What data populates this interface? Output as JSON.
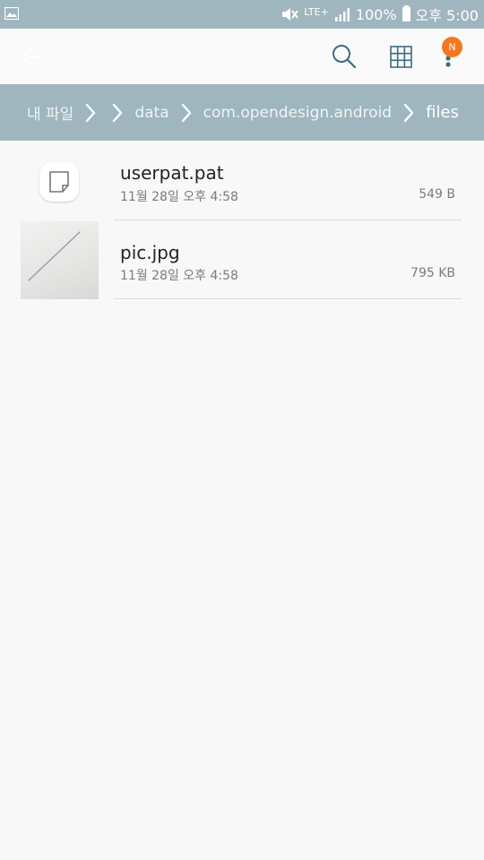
{
  "status_bar": {
    "network": "LTE+",
    "battery": "100%",
    "time": "오후 5:00"
  },
  "app_bar": {
    "notification_badge": "N",
    "accent_color": "#f4781f"
  },
  "breadcrumb": [
    "내 파일",
    "data",
    "com.opendesign.android",
    "files"
  ],
  "files": [
    {
      "name": "userpat.pat",
      "date": "11월 28일 오후 4:58",
      "size": "549 B",
      "icon": "document-icon"
    },
    {
      "name": "pic.jpg",
      "date": "11월 28일 오후 4:58",
      "size": "795 KB",
      "icon": "image-thumbnail"
    }
  ],
  "colors": {
    "header": "#9fb6be",
    "background": "#f8f8f8"
  }
}
